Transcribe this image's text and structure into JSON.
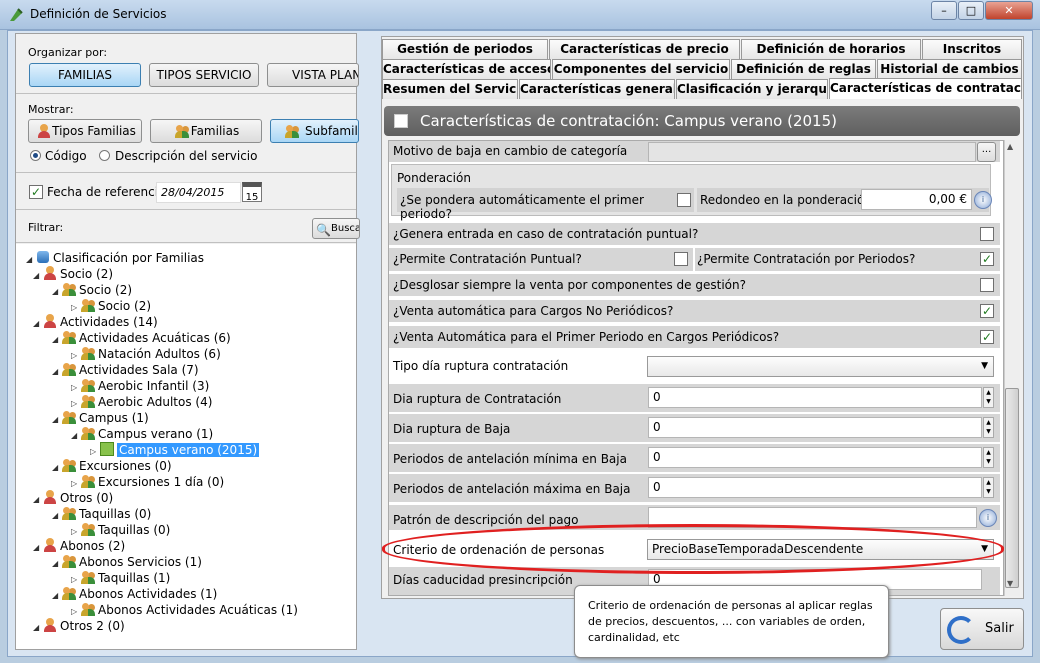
{
  "window": {
    "title": "Definición de Servicios"
  },
  "left": {
    "organize_label": "Organizar por:",
    "organize_buttons": [
      "FAMILIAS",
      "TIPOS SERVICIO",
      "VISTA PLANA"
    ],
    "show_label": "Mostrar:",
    "show_buttons": [
      "Tipos Familias",
      "Familias",
      "Subfamilias"
    ],
    "radio_code": "Código",
    "radio_desc": "Descripción del servicio",
    "ref_date_label": "Fecha de referencia:",
    "ref_date_value": "28/04/2015",
    "calendar_day": "15",
    "filter_label": "Filtrar:",
    "search_button": "Buscar",
    "tree": [
      {
        "text": "Clasificación por Familias",
        "icon": "db",
        "level": 0
      },
      {
        "text": "Socio (2)",
        "icon": "user",
        "level": 1
      },
      {
        "text": "Socio (2)",
        "icon": "fam",
        "level": 2
      },
      {
        "text": "Socio (2)",
        "icon": "fam",
        "level": 3
      },
      {
        "text": "Actividades (14)",
        "icon": "user",
        "level": 1
      },
      {
        "text": "Actividades Acuáticas (6)",
        "icon": "fam",
        "level": 2
      },
      {
        "text": "Natación Adultos (6)",
        "icon": "fam",
        "level": 3
      },
      {
        "text": "Actividades Sala (7)",
        "icon": "fam",
        "level": 2
      },
      {
        "text": "Aerobic Infantil (3)",
        "icon": "fam",
        "level": 3
      },
      {
        "text": "Aerobic Adultos (4)",
        "icon": "fam",
        "level": 3
      },
      {
        "text": "Campus (1)",
        "icon": "fam",
        "level": 2
      },
      {
        "text": "Campus verano (1)",
        "icon": "fam",
        "level": 3
      },
      {
        "text": "Campus verano (2015)",
        "icon": "green",
        "level": 4,
        "selected": true
      },
      {
        "text": "Excursiones (0)",
        "icon": "fam",
        "level": 2
      },
      {
        "text": "Excursiones 1 día (0)",
        "icon": "fam",
        "level": 3
      },
      {
        "text": "Otros (0)",
        "icon": "user",
        "level": 1
      },
      {
        "text": "Taquillas (0)",
        "icon": "fam",
        "level": 2
      },
      {
        "text": "Taquillas (0)",
        "icon": "fam",
        "level": 3
      },
      {
        "text": "Abonos (2)",
        "icon": "user",
        "level": 1
      },
      {
        "text": "Abonos Servicios (1)",
        "icon": "fam",
        "level": 2
      },
      {
        "text": "Taquillas (1)",
        "icon": "fam",
        "level": 3
      },
      {
        "text": "Abonos Actividades (1)",
        "icon": "fam",
        "level": 2
      },
      {
        "text": "Abonos Actividades Acuáticas (1)",
        "icon": "fam",
        "level": 3
      },
      {
        "text": "Otros 2 (0)",
        "icon": "user",
        "level": 1
      }
    ]
  },
  "tabs": {
    "row1": [
      "Gestión de periodos",
      "Características de precio",
      "Definición de horarios",
      "Inscritos"
    ],
    "row2": [
      "Características de acceso",
      "Componentes del servicio",
      "Definición de reglas",
      "Historial de cambios"
    ],
    "row3": [
      "Resumen del Servicio",
      "Características generales",
      "Clasificación y jerarquía",
      "Características de contrataci..."
    ]
  },
  "header": {
    "title": "Características de contratación: Campus verano (2015)"
  },
  "form": {
    "motivo_baja": "Motivo de baja en cambio de categoría",
    "ponderacion": "Ponderación",
    "pondera_primer": "¿Se pondera automáticamente el primer periodo?",
    "redondeo": "Redondeo en la ponderación",
    "redondeo_value": "0,00 €",
    "genera_entrada": "¿Genera entrada en caso de contratación puntual?",
    "permite_puntual": "¿Permite Contratación Puntual?",
    "permite_periodos": "¿Permite Contratación por Periodos?",
    "desglosar": "¿Desglosar siempre la venta por componentes de gestión?",
    "venta_no_periodicos": "¿Venta automática para Cargos No Periódicos?",
    "venta_primer_periodo": "¿Venta Automática para el Primer Periodo en Cargos Periódicos?",
    "tipo_dia_ruptura": "Tipo día ruptura contratación",
    "dia_ruptura_contratacion": "Dia ruptura de Contratación",
    "dia_ruptura_contratacion_value": "0",
    "dia_ruptura_baja": "Dia ruptura de Baja",
    "dia_ruptura_baja_value": "0",
    "antelacion_minima": "Periodos de antelación mínima en Baja",
    "antelacion_minima_value": "0",
    "antelacion_maxima": "Periodos de antelación máxima en Baja",
    "antelacion_maxima_value": "0",
    "patron_descripcion": "Patrón de descripción del pago",
    "criterio_ordenacion": "Criterio de ordenación de personas",
    "criterio_ordenacion_value": "PrecioBaseTemporadaDescendente",
    "dias_caducidad": "Días caducidad presincripción",
    "dias_caducidad_value": "0"
  },
  "tooltip": {
    "text": "Criterio de ordenación de personas al aplicar reglas de precios, descuentos, ... con variables de orden, cardinalidad, etc"
  },
  "exit_button": "Salir",
  "colors": {
    "highlight": "#e02020",
    "selection": "#3399ff",
    "header_bg": "#6b6b6b"
  }
}
